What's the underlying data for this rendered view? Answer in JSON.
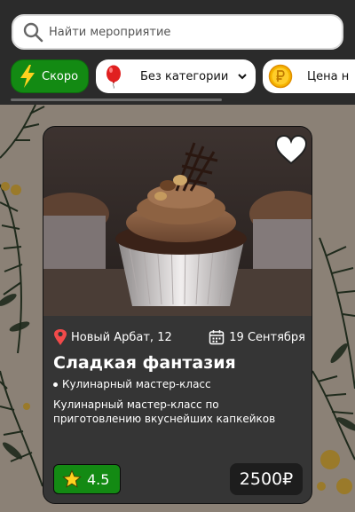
{
  "search": {
    "placeholder": "Найти мероприятие"
  },
  "filters": {
    "soon_label": "Скоро",
    "category_selected": "Без категории",
    "price_label": "Цена н"
  },
  "colors": {
    "accent_green": "#138a13",
    "card_bg": "#353535",
    "header_bg": "#2b2b2b",
    "price_bg": "#1d1d1d"
  },
  "event": {
    "location": "Новый Арбат, 12",
    "date": "19 Сентября",
    "title": "Сладкая фантазия",
    "category": "Кулинарный мастер-класс",
    "description": "Кулинарный мастер-класс по приготовлению вкуснейших капкейков",
    "rating": "4.5",
    "price": "2500₽",
    "image_subject": "chocolate cupcakes"
  },
  "icons": {
    "search": "search-icon",
    "soon": "lightning-icon",
    "category": "balloon-icon",
    "price": "ruble-coin-icon",
    "favorite": "heart-icon",
    "location": "map-pin-icon",
    "date": "calendar-icon",
    "rating": "star-icon"
  }
}
